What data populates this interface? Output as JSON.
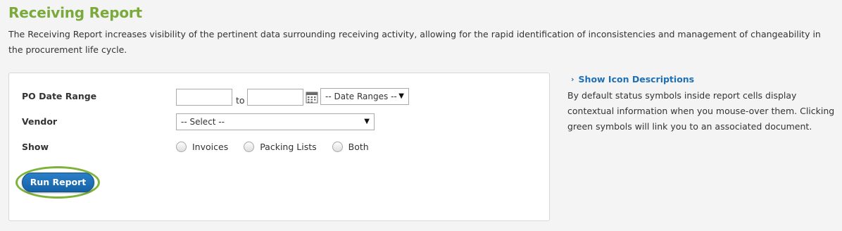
{
  "header": {
    "title": "Receiving Report",
    "description": "The Receiving Report increases visibility of the pertinent data surrounding receiving activity, allowing for the rapid identification of inconsistencies and management of changeability in the procurement life cycle."
  },
  "form": {
    "po_date_range": {
      "label": "PO Date Range",
      "from_value": "",
      "to_label": "to",
      "to_value": "",
      "date_ranges_select": "-- Date Ranges --"
    },
    "vendor": {
      "label": "Vendor",
      "selected": "-- Select --"
    },
    "show": {
      "label": "Show",
      "options": [
        "Invoices",
        "Packing Lists",
        "Both"
      ]
    },
    "run_button": "Run Report"
  },
  "sidebar": {
    "link": "Show Icon Descriptions",
    "text": "By default status symbols inside report cells display contextual information when you mouse-over them. Clicking green symbols will link you to an associated document."
  },
  "colors": {
    "title_green": "#7aaa3c",
    "link_blue": "#1f6fb5",
    "button_blue": "#1462a8",
    "highlight_green": "#7db33a"
  },
  "icons": [
    "calendar-icon",
    "chevron-right-icon",
    "caret-down-icon"
  ]
}
